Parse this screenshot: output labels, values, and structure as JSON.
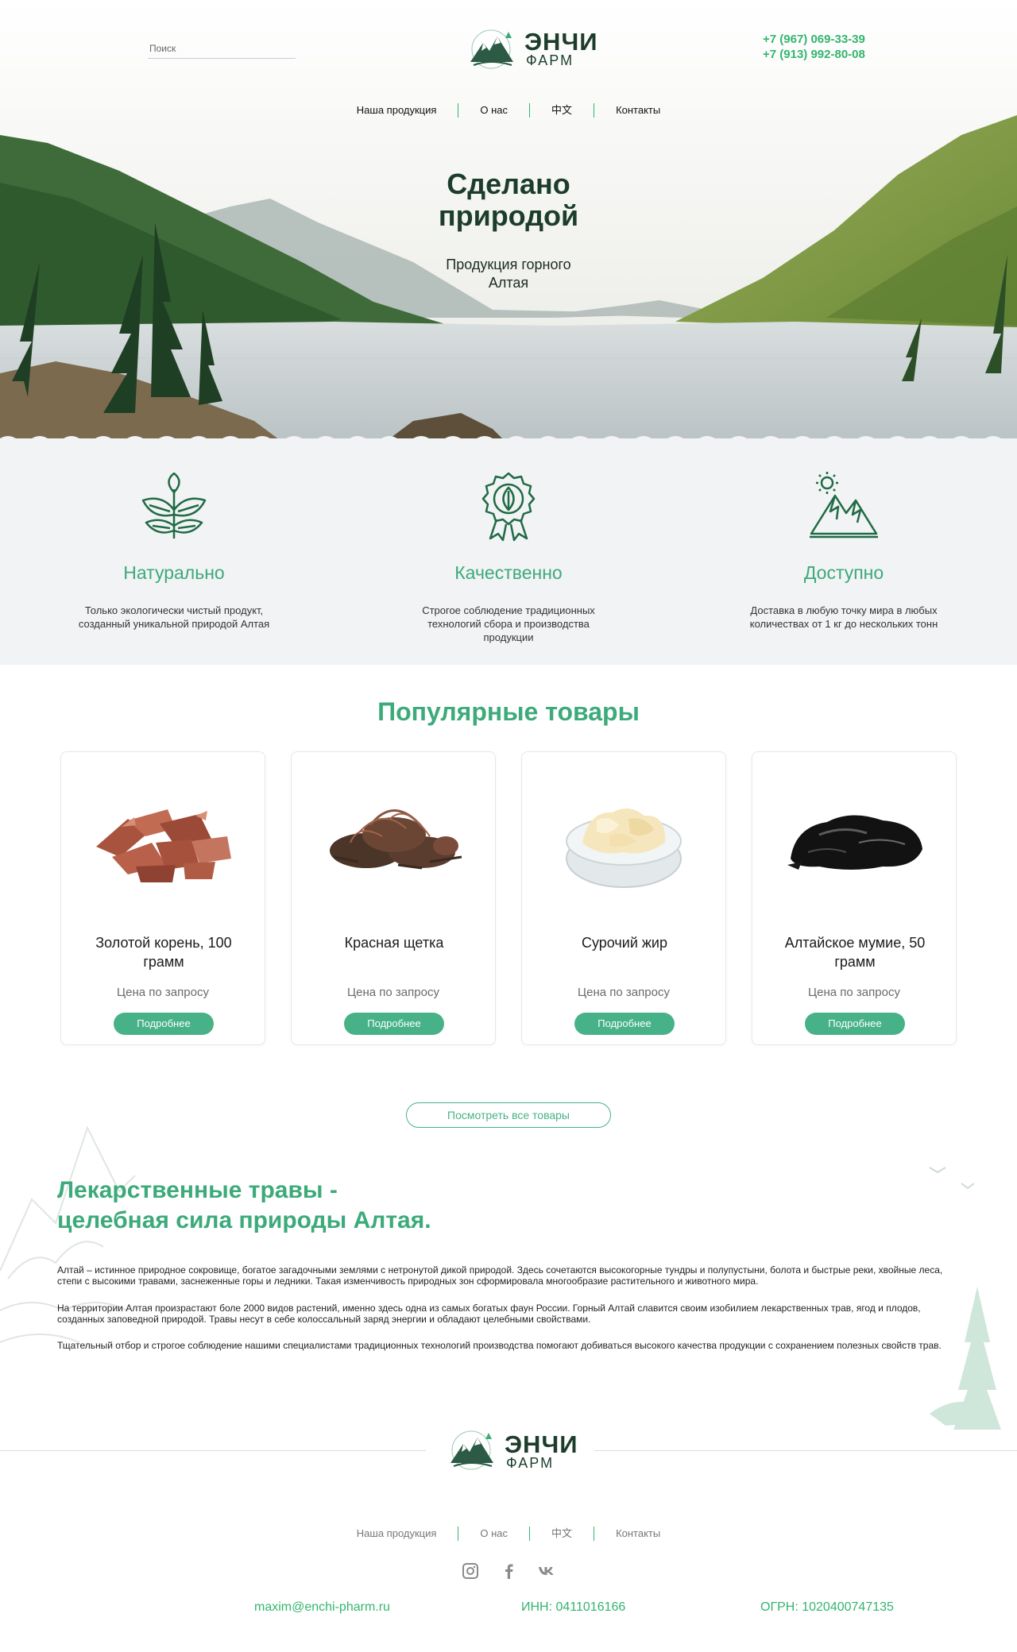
{
  "header": {
    "search_placeholder": "Поиск",
    "brand": "ЭНЧИ",
    "brand_sub": "ФАРМ",
    "phones": [
      "+7 (967) 069-33-39",
      "+7 (913) 992-80-08"
    ],
    "nav": [
      "Наша продукция",
      "О нас",
      "中文",
      "Контакты"
    ]
  },
  "hero": {
    "title_line1": "Сделано",
    "title_line2": "природой",
    "subtitle": "Продукция горного Алтая"
  },
  "features": [
    {
      "icon": "leaf-icon",
      "title": "Натурально",
      "text": "Только экологически чистый продукт, созданный уникальной природой Алтая"
    },
    {
      "icon": "quality-badge-icon",
      "title": "Качественно",
      "text": "Строгое соблюдение традиционных технологий сбора и производства продукции"
    },
    {
      "icon": "mountain-icon",
      "title": "Доступно",
      "text": "Доставка в любую точку мира в любых количествах от 1 кг до нескольких тонн"
    }
  ],
  "popular": {
    "title": "Популярные товары",
    "products": [
      {
        "name": "Золотой корень, 100 грамм",
        "price": "Цена по запросу",
        "button": "Подробнее"
      },
      {
        "name": "Красная щетка",
        "price": "Цена по запросу",
        "button": "Подробнее"
      },
      {
        "name": "Сурочий жир",
        "price": "Цена по запросу",
        "button": "Подробнее"
      },
      {
        "name": "Алтайское мумие, 50 грамм",
        "price": "Цена по запросу",
        "button": "Подробнее"
      }
    ],
    "all_button": "Посмотреть все товары"
  },
  "herbs": {
    "title_line1": "Лекарственные травы -",
    "title_line2": "целебная сила природы Алтая.",
    "paragraphs": [
      "Алтай – истинное природное сокровище, богатое загадочными землями с нетронутой дикой природой. Здесь сочетаются высокогорные тундры и полупустыни, болота и быстрые реки, хвойные леса, степи с высокими травами, заснеженные горы и ледники. Такая изменчивость природных зон сформировала многообразие растительного и животного мира.",
      "На территории Алтая произрастают боле 2000 видов растений, именно здесь одна из самых богатых фаун России. Горный Алтай славится своим изобилием лекарственных трав, ягод и плодов, созданных заповедной природой. Травы несут в себе колоссальный заряд энергии и обладают целебными свойствами.",
      "Тщательный отбор и строгое соблюдение нашими специалистами традиционных технологий производства помогают добиваться высокого качества продукции с сохранением полезных свойств трав."
    ]
  },
  "footer": {
    "brand": "ЭНЧИ",
    "brand_sub": "ФАРМ",
    "nav": [
      "Наша продукция",
      "О нас",
      "中文",
      "Контакты"
    ],
    "social": [
      "instagram-icon",
      "facebook-icon",
      "vk-icon"
    ],
    "email": "maxim@enchi-pharm.ru",
    "inn": "ИНН: 0411016166",
    "ogrn": "ОГРН: 1020400747135"
  },
  "colors": {
    "accent": "#3daa7a",
    "dark_green": "#1d3d2c",
    "phone_green": "#34b56e",
    "button": "#47b287"
  }
}
